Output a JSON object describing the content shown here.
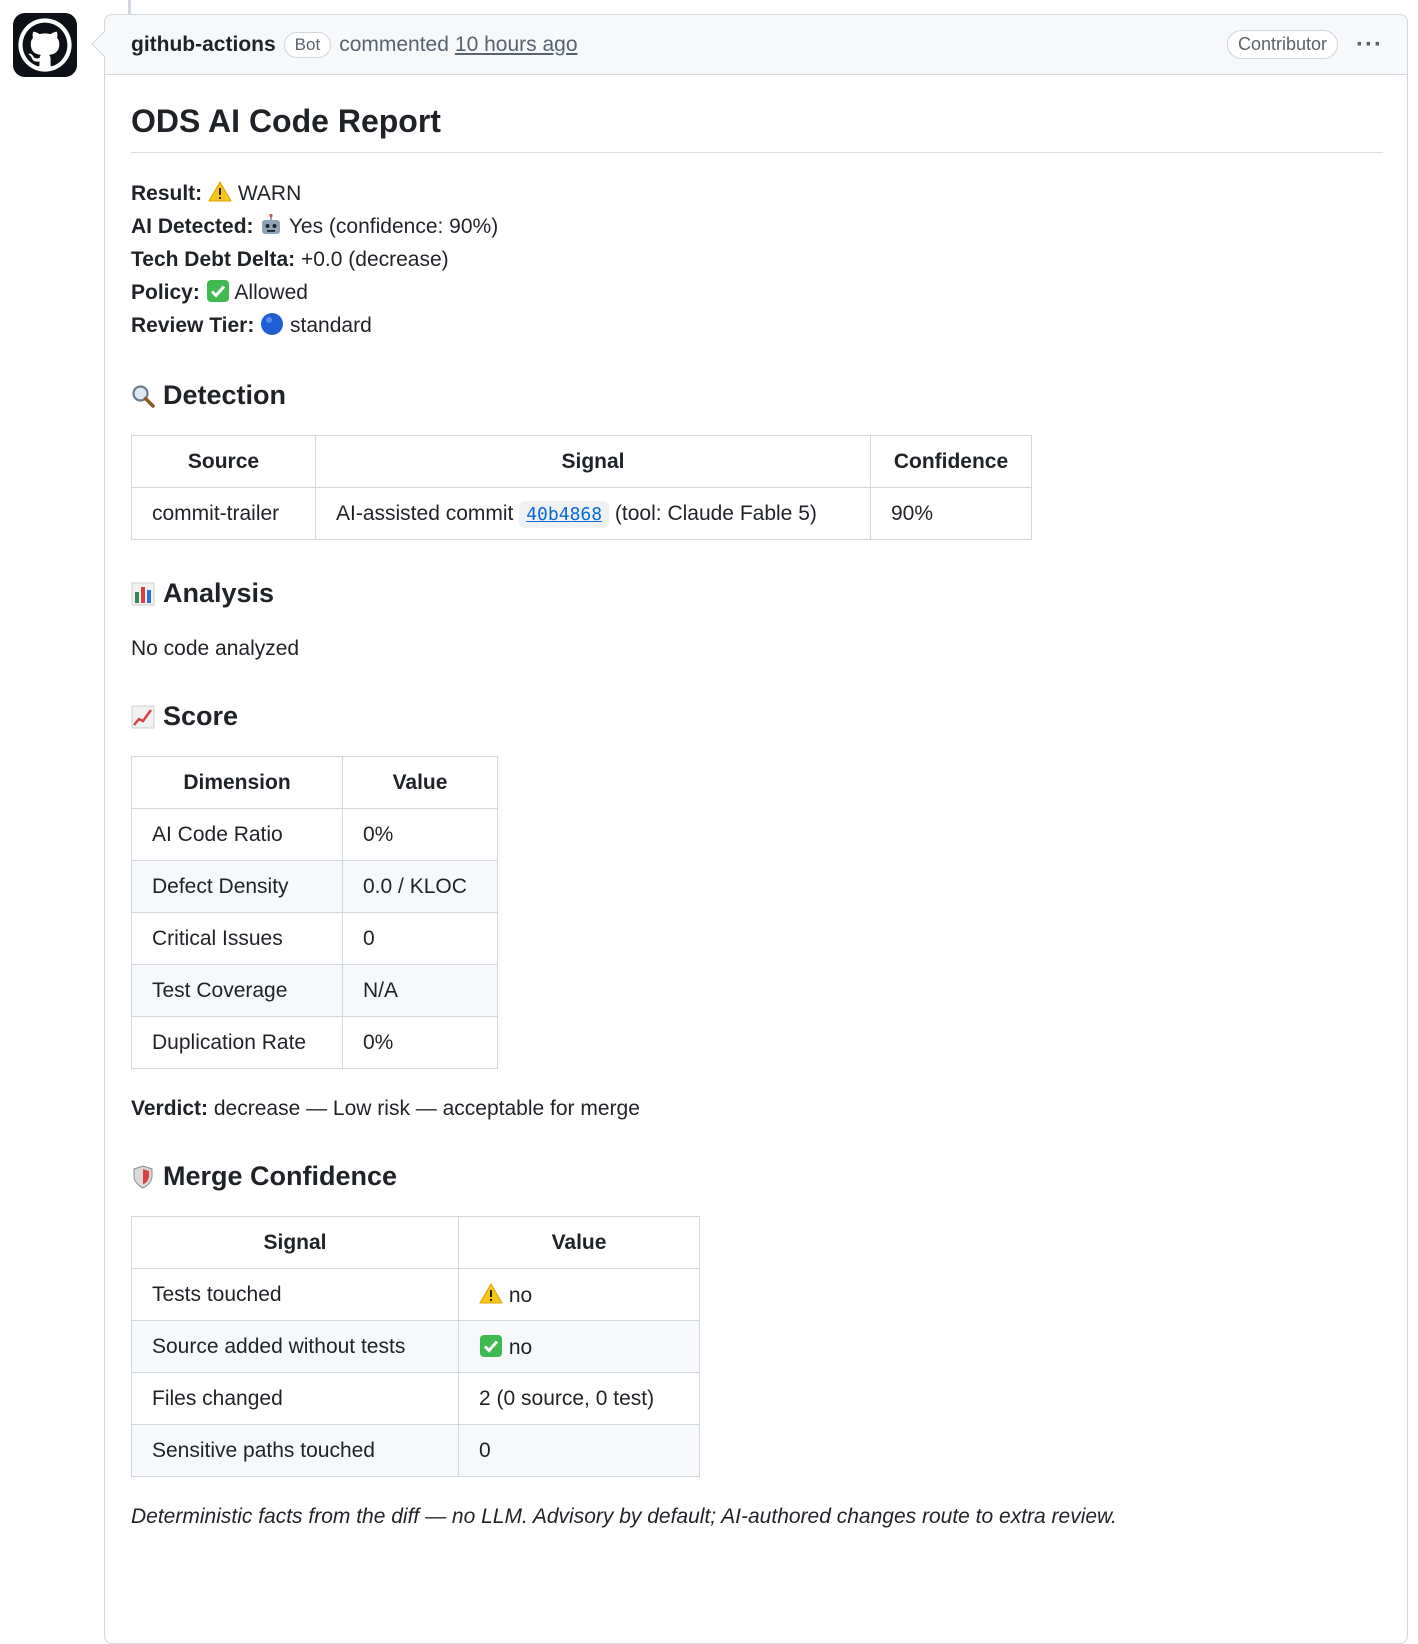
{
  "comment": {
    "author": "github-actions",
    "bot_badge": "Bot",
    "commented": "commented",
    "time": "10 hours ago",
    "role": "Contributor",
    "menu": "···"
  },
  "report": {
    "title": "ODS AI Code Report",
    "summary": [
      {
        "label": "Result:",
        "icon": "warning-icon",
        "value": "WARN"
      },
      {
        "label": "AI Detected:",
        "icon": "robot-icon",
        "value": "Yes (confidence: 90%)"
      },
      {
        "label": "Tech Debt Delta:",
        "icon": "",
        "value": "+0.0 (decrease)"
      },
      {
        "label": "Policy:",
        "icon": "check-icon",
        "value": "Allowed"
      },
      {
        "label": "Review Tier:",
        "icon": "blue-circle-icon",
        "value": "standard"
      }
    ],
    "detection": {
      "heading": "Detection",
      "headers": [
        "Source",
        "Signal",
        "Confidence"
      ],
      "row": {
        "source": "commit-trailer",
        "signal_prefix": "AI-assisted commit",
        "sha": "40b4868",
        "signal_suffix": "(tool: Claude Fable 5)",
        "confidence": "90%"
      }
    },
    "analysis": {
      "heading": "Analysis",
      "text": "No code analyzed"
    },
    "score": {
      "heading": "Score",
      "headers": [
        "Dimension",
        "Value"
      ],
      "rows": [
        [
          "AI Code Ratio",
          "0%"
        ],
        [
          "Defect Density",
          "0.0 / KLOC"
        ],
        [
          "Critical Issues",
          "0"
        ],
        [
          "Test Coverage",
          "N/A"
        ],
        [
          "Duplication Rate",
          "0%"
        ]
      ],
      "verdict_label": "Verdict:",
      "verdict_text": "decrease — Low risk — acceptable for merge"
    },
    "merge": {
      "heading": "Merge Confidence",
      "headers": [
        "Signal",
        "Value"
      ],
      "rows": [
        {
          "signal": "Tests touched",
          "icon": "warning-icon",
          "value": "no"
        },
        {
          "signal": "Source added without tests",
          "icon": "check-icon",
          "value": "no"
        },
        {
          "signal": "Files changed",
          "icon": "",
          "value": "2 (0 source, 0 test)"
        },
        {
          "signal": "Sensitive paths touched",
          "icon": "",
          "value": "0"
        }
      ]
    },
    "footer": "Deterministic facts from the diff — no LLM. Advisory by default; AI-authored changes route to extra review."
  },
  "colors": {
    "link": "#0969da",
    "border": "#d0d7de",
    "header_bg": "#f6f8fa",
    "text": "#1f2328",
    "muted": "#59636e"
  }
}
